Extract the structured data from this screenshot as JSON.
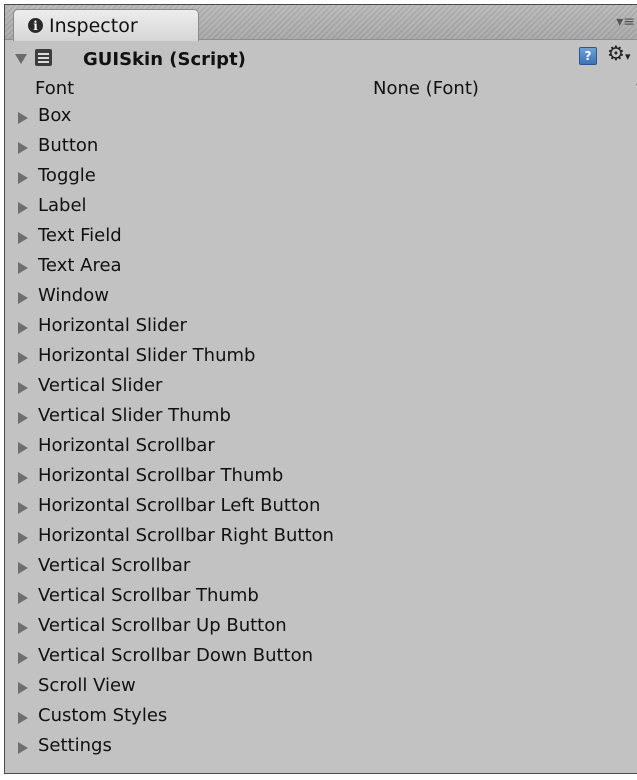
{
  "tab": {
    "label": "Inspector"
  },
  "component": {
    "title": "GUISkin (Script)"
  },
  "font_property": {
    "label": "Font",
    "value": "None (Font)"
  },
  "items": [
    "Box",
    "Button",
    "Toggle",
    "Label",
    "Text Field",
    "Text Area",
    "Window",
    "Horizontal Slider",
    "Horizontal Slider Thumb",
    "Vertical Slider",
    "Vertical Slider Thumb",
    "Horizontal Scrollbar",
    "Horizontal Scrollbar Thumb",
    "Horizontal Scrollbar Left Button",
    "Horizontal Scrollbar Right Button",
    "Vertical Scrollbar",
    "Vertical Scrollbar Thumb",
    "Vertical Scrollbar Up Button",
    "Vertical Scrollbar Down Button",
    "Scroll View",
    "Custom Styles",
    "Settings"
  ],
  "icons": {
    "tab": "info-icon",
    "fold": "fold-down-icon",
    "component": "script-icon",
    "help": "help-icon",
    "settings": "gear-icon",
    "panel_menu": "panel-menu-icon",
    "row": "expand-triangle-icon"
  },
  "colors": {
    "panel": "#c2c2c2",
    "tab": "#e4e4e4",
    "help": "#4a82c6",
    "text": "#111111"
  }
}
